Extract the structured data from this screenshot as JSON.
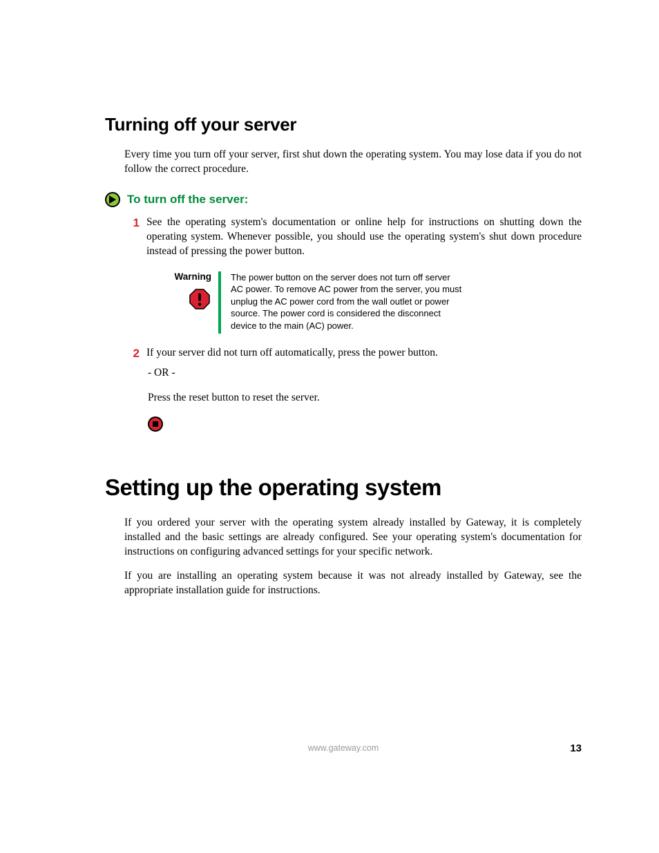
{
  "section1": {
    "heading": "Turning off your server",
    "intro": "Every time you turn off your server, first shut down the operating system. You may lose data if you do not follow the correct procedure.",
    "procedure_title": "To turn off the server:",
    "steps": [
      {
        "num": "1",
        "text": "See the operating system's documentation or online help for instructions on shutting down the operating system. Whenever possible, you should use the operating system's shut down procedure instead of pressing the power button."
      },
      {
        "num": "2",
        "text": "If your server did not turn off automatically, press the power button."
      }
    ],
    "warning": {
      "label": "Warning",
      "text": "The power button on the server does not turn off server AC power. To remove AC power from the server, you must unplug the AC power cord from the wall outlet or power source. The power cord is considered the disconnect device to the main (AC) power."
    },
    "or_text": "- OR -",
    "reset_text": "Press the reset button to reset the server."
  },
  "section2": {
    "heading": "Setting up the operating system",
    "para1": "If you ordered your server with the operating system already installed by Gateway, it is completely installed and the basic settings are already configured. See your operating system's documentation for instructions on configuring advanced settings for your specific network.",
    "para2": "If you are installing an operating system because it was not already installed by Gateway, see the appropriate installation guide for instructions."
  },
  "footer": {
    "url": "www.gateway.com",
    "page": "13"
  }
}
